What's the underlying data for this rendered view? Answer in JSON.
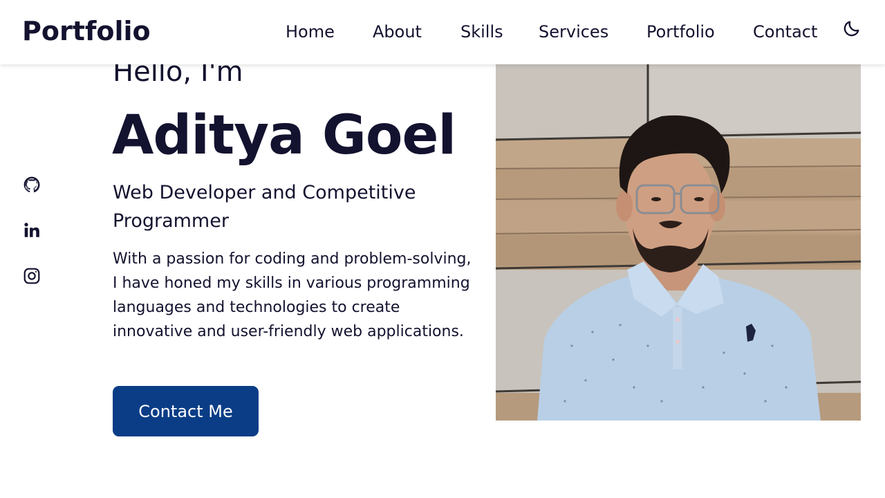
{
  "header": {
    "logo": "Portfolio",
    "nav": [
      {
        "label": "Home"
      },
      {
        "label": "About"
      },
      {
        "label": "Skills"
      },
      {
        "label": "Services"
      },
      {
        "label": "Portfolio"
      },
      {
        "label": "Contact"
      }
    ],
    "theme_toggle_icon": "moon-icon"
  },
  "social": [
    {
      "icon": "github-icon"
    },
    {
      "icon": "linkedin-icon"
    },
    {
      "icon": "instagram-icon"
    }
  ],
  "hero": {
    "greeting": "Hello, I'm",
    "name": "Aditya Goel",
    "subtitle": "Web Developer and Competitive Programmer",
    "description": "With a passion for coding and problem-solving, I have honed my skills in various programming languages and technologies to create innovative and user-friendly web applications.",
    "cta_label": "Contact Me"
  },
  "colors": {
    "text": "#13122f",
    "accent": "#0a3d86",
    "background": "#ffffff"
  }
}
